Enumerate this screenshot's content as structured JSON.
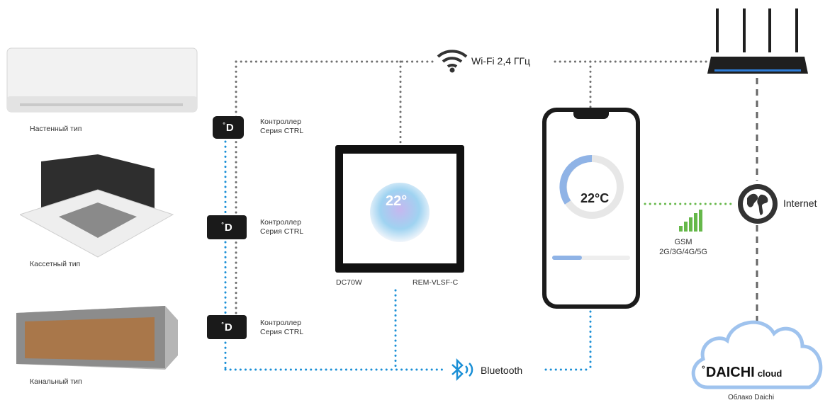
{
  "units": [
    {
      "label": "Настенный тип"
    },
    {
      "label": "Кассетный тип"
    },
    {
      "label": "Канальный тип"
    }
  ],
  "controllers": [
    {
      "logo": "D",
      "line1": "Контроллер",
      "line2": "Серия CTRL"
    },
    {
      "logo": "D",
      "line1": "Контроллер",
      "line2": "Серия CTRL"
    },
    {
      "logo": "D",
      "line1": "Контроллер",
      "line2": "Серия CTRL"
    }
  ],
  "wifi": {
    "label": "Wi-Fi 2,4 ГГц",
    "icon": "wifi-icon"
  },
  "bluetooth": {
    "label": "Bluetooth",
    "icon": "bluetooth-icon"
  },
  "panel": {
    "model_left": "DC70W",
    "model_right": "REM-VLSF-C",
    "temp": "22°"
  },
  "phone": {
    "temp": "22°C"
  },
  "internet": {
    "label": "Internet",
    "icon": "globe-icon"
  },
  "gsm": {
    "line1": "GSM",
    "line2": "2G/3G/4G/5G",
    "icon": "signal-bars-icon"
  },
  "cloud": {
    "brand": "DAICHI",
    "suffix": "cloud",
    "caption": "Облако Daichi"
  },
  "colors": {
    "wifi_line": "#6f6f6f",
    "bt_line": "#1a8fd6",
    "gsm_line": "#66b84a",
    "internet_line": "#666666"
  }
}
